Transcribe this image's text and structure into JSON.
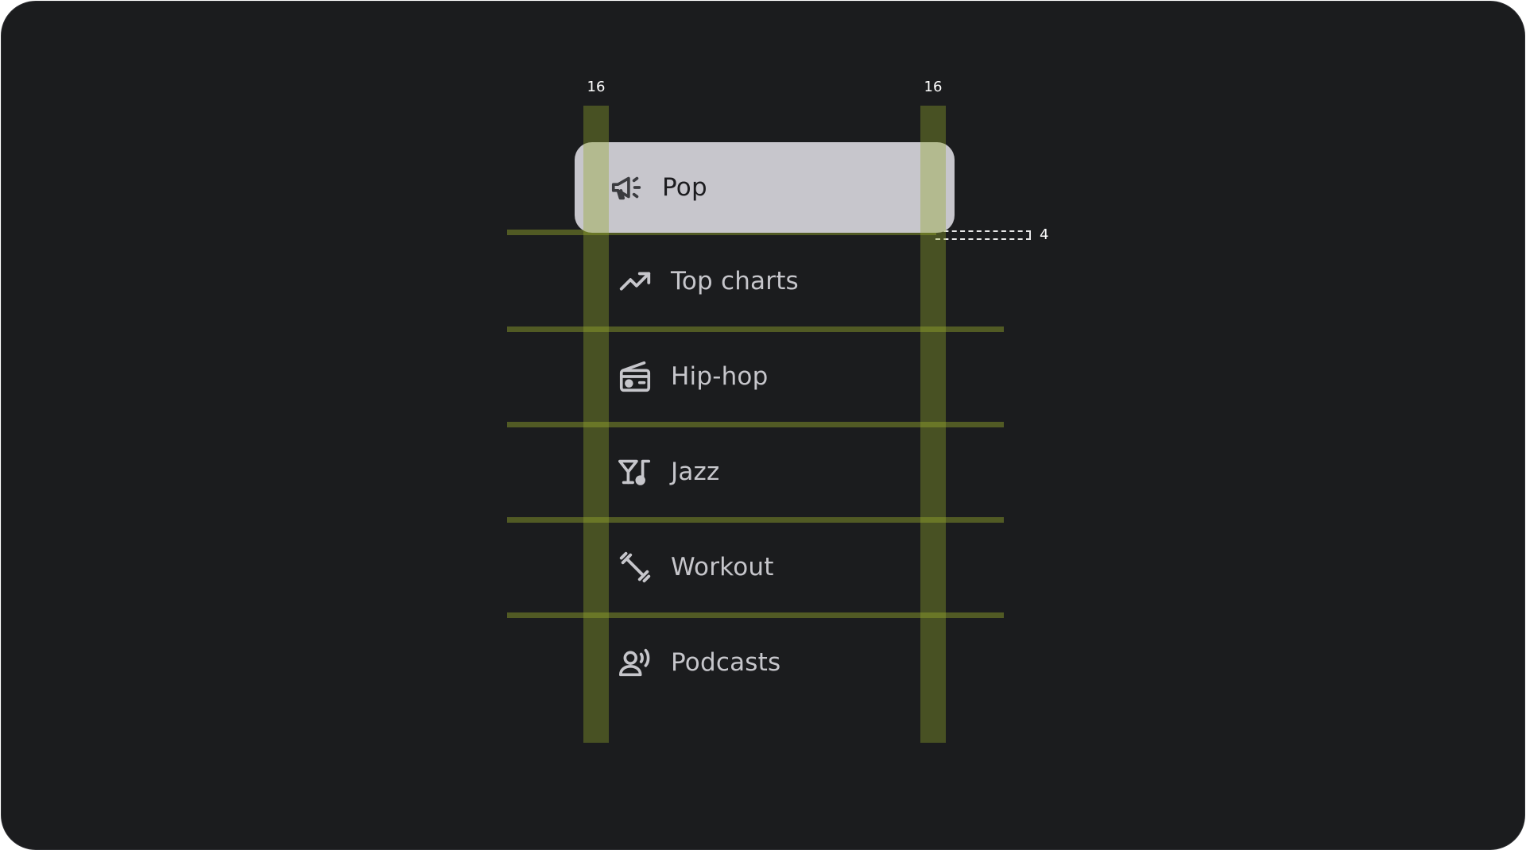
{
  "spec": {
    "left_padding_label": "16",
    "right_padding_label": "16",
    "gap_label": "4"
  },
  "nav": {
    "items": [
      {
        "label": "Pop",
        "icon": "campaign-icon",
        "selected": true
      },
      {
        "label": "Top charts",
        "icon": "trending-up-icon",
        "selected": false
      },
      {
        "label": "Hip-hop",
        "icon": "radio-icon",
        "selected": false
      },
      {
        "label": "Jazz",
        "icon": "nightlife-icon",
        "selected": false
      },
      {
        "label": "Workout",
        "icon": "fitness-icon",
        "selected": false
      },
      {
        "label": "Podcasts",
        "icon": "record-voice-icon",
        "selected": false
      }
    ]
  },
  "colors": {
    "background": "#1b1c1e",
    "active_container": "#c7c6cc",
    "overlay": "#94a72c",
    "label": "#c6c6cb",
    "active_label": "#1c1c1f"
  }
}
